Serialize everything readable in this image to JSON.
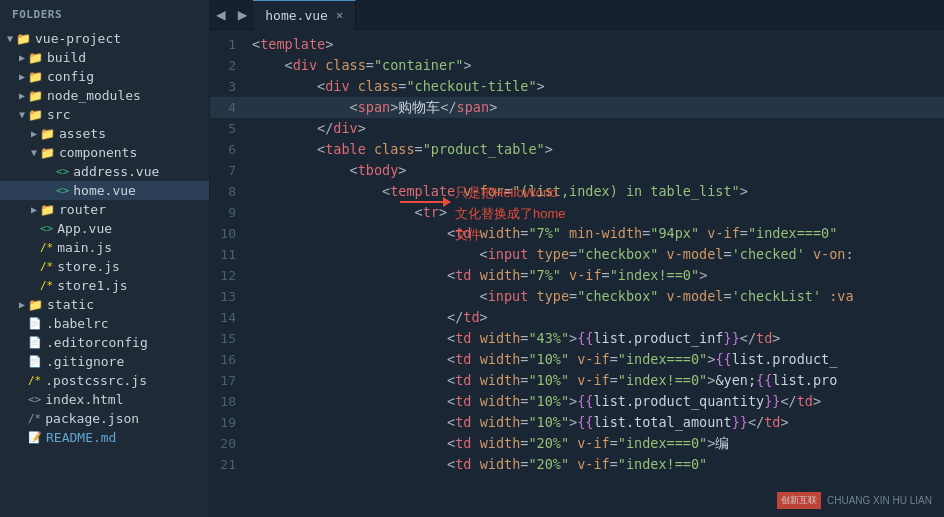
{
  "sidebar": {
    "header": "FOLDERS",
    "items": [
      {
        "id": "vue-project",
        "label": "vue-project",
        "type": "folder",
        "indent": 0,
        "arrow": "open"
      },
      {
        "id": "build",
        "label": "build",
        "type": "folder",
        "indent": 1,
        "arrow": "closed"
      },
      {
        "id": "config",
        "label": "config",
        "type": "folder",
        "indent": 1,
        "arrow": "closed"
      },
      {
        "id": "node_modules",
        "label": "node_modules",
        "type": "folder",
        "indent": 1,
        "arrow": "closed"
      },
      {
        "id": "src",
        "label": "src",
        "type": "folder",
        "indent": 1,
        "arrow": "open"
      },
      {
        "id": "assets",
        "label": "assets",
        "type": "folder",
        "indent": 2,
        "arrow": "closed"
      },
      {
        "id": "components",
        "label": "components",
        "type": "folder",
        "indent": 2,
        "arrow": "open"
      },
      {
        "id": "address-vue",
        "label": "address.vue",
        "type": "file-vue",
        "indent": 3,
        "arrow": "empty"
      },
      {
        "id": "home-vue",
        "label": "home.vue",
        "type": "file-vue",
        "indent": 3,
        "arrow": "empty",
        "selected": true
      },
      {
        "id": "router",
        "label": "router",
        "type": "folder",
        "indent": 2,
        "arrow": "closed"
      },
      {
        "id": "app-vue",
        "label": "App.vue",
        "type": "file-vue",
        "indent": 2,
        "arrow": "empty"
      },
      {
        "id": "main-js",
        "label": "main.js",
        "type": "file-js",
        "indent": 2,
        "arrow": "empty"
      },
      {
        "id": "store-js",
        "label": "store.js",
        "type": "file-js",
        "indent": 2,
        "arrow": "empty"
      },
      {
        "id": "store1-js",
        "label": "store1.js",
        "type": "file-js",
        "indent": 2,
        "arrow": "empty"
      },
      {
        "id": "static",
        "label": "static",
        "type": "folder",
        "indent": 1,
        "arrow": "closed"
      },
      {
        "id": "babelrc",
        "label": ".babelrc",
        "type": "file-other",
        "indent": 1,
        "arrow": "empty"
      },
      {
        "id": "editorconfig",
        "label": ".editorconfig",
        "type": "file-other",
        "indent": 1,
        "arrow": "empty"
      },
      {
        "id": "gitignore",
        "label": ".gitignore",
        "type": "file-other",
        "indent": 1,
        "arrow": "empty"
      },
      {
        "id": "postcssrc",
        "label": ".postcssrc.js",
        "type": "file-js",
        "indent": 1,
        "arrow": "empty"
      },
      {
        "id": "index-html",
        "label": "index.html",
        "type": "file-other",
        "indent": 1,
        "arrow": "empty"
      },
      {
        "id": "package-json",
        "label": "package.json",
        "type": "file-other",
        "indent": 1,
        "arrow": "empty"
      },
      {
        "id": "readme-md",
        "label": "README.md",
        "type": "file-md",
        "indent": 1,
        "arrow": "empty"
      }
    ]
  },
  "tabs": [
    {
      "label": "home.vue",
      "active": true
    }
  ],
  "code": {
    "lines": [
      {
        "n": 1,
        "html": "<span class='c-bracket'>&lt;</span><span class='c-tag'>template</span><span class='c-bracket'>&gt;</span>"
      },
      {
        "n": 2,
        "html": "    <span class='c-bracket'>&lt;</span><span class='c-tag'>div</span> <span class='c-attr'>class</span><span class='c-bracket'>=</span><span class='c-string'>\"container\"</span><span class='c-bracket'>&gt;</span>"
      },
      {
        "n": 3,
        "html": "        <span class='c-bracket'>&lt;</span><span class='c-tag'>div</span> <span class='c-attr'>class</span><span class='c-bracket'>=</span><span class='c-string'>\"checkout-title\"</span><span class='c-bracket'>&gt;</span>"
      },
      {
        "n": 4,
        "html": "            <span class='c-bracket'>&lt;</span><span class='c-tag'>span</span><span class='c-bracket'>&gt;</span><span class='c-text'>购物车</span><span class='c-bracket'>&lt;/</span><span class='c-tag'>span</span><span class='c-bracket'>&gt;</span>",
        "highlighted": true
      },
      {
        "n": 5,
        "html": "        <span class='c-bracket'>&lt;/</span><span class='c-tag'>div</span><span class='c-bracket'>&gt;</span>"
      },
      {
        "n": 6,
        "html": "        <span class='c-bracket'>&lt;</span><span class='c-tag'>table</span> <span class='c-attr'>class</span><span class='c-bracket'>=</span><span class='c-string'>\"product_table\"</span><span class='c-bracket'>&gt;</span>"
      },
      {
        "n": 7,
        "html": "            <span class='c-bracket'>&lt;</span><span class='c-tag'>tbody</span><span class='c-bracket'>&gt;</span>"
      },
      {
        "n": 8,
        "html": "                <span class='c-bracket'>&lt;</span><span class='c-tag'>template</span> <span class='c-attr'>v-for</span><span class='c-bracket'>=</span><span class='c-string'>\"(list,index) in table_list\"</span><span class='c-bracket'>&gt;</span>"
      },
      {
        "n": 9,
        "html": "                    <span class='c-bracket'>&lt;</span><span class='c-tag'>tr</span><span class='c-bracket'>&gt;</span>"
      },
      {
        "n": 10,
        "html": "                        <span class='c-bracket'>&lt;</span><span class='c-tag'>td</span> <span class='c-attr'>width</span><span class='c-bracket'>=</span><span class='c-string'>\"7%\"</span> <span class='c-attr'>min-width</span><span class='c-bracket'>=</span><span class='c-string'>\"94px\"</span> <span class='c-attr'>v-if</span><span class='c-bracket'>=</span><span class='c-string'>\"index===0\"</span>"
      },
      {
        "n": 11,
        "html": "                            <span class='c-bracket'>&lt;</span><span class='c-tag'>input</span> <span class='c-attr'>type</span><span class='c-bracket'>=</span><span class='c-string'>\"checkbox\"</span> <span class='c-attr'>v-model</span><span class='c-bracket'>=</span><span class='c-string'>'checked'</span> <span class='c-attr'>v-on</span><span class='c-bracket'>:</span>"
      },
      {
        "n": 12,
        "html": "                        <span class='c-bracket'>&lt;</span><span class='c-tag'>td</span> <span class='c-attr'>width</span><span class='c-bracket'>=</span><span class='c-string'>\"7%\"</span> <span class='c-attr'>v-if</span><span class='c-bracket'>=</span><span class='c-string'>\"index!==0\"</span><span class='c-bracket'>&gt;</span>"
      },
      {
        "n": 13,
        "html": "                            <span class='c-bracket'>&lt;</span><span class='c-tag'>input</span> <span class='c-attr'>type</span><span class='c-bracket'>=</span><span class='c-string'>\"checkbox\"</span> <span class='c-attr'>v-model</span><span class='c-bracket'>=</span><span class='c-string'>'checkList'</span> <span class='c-attr'>:va</span>"
      },
      {
        "n": 14,
        "html": "                        <span class='c-bracket'>&lt;/</span><span class='c-tag'>td</span><span class='c-bracket'>&gt;</span>"
      },
      {
        "n": 15,
        "html": "                        <span class='c-bracket'>&lt;</span><span class='c-tag'>td</span> <span class='c-attr'>width</span><span class='c-bracket'>=</span><span class='c-string'>\"43%\"</span><span class='c-bracket'>&gt;</span><span class='c-mustache'>{{</span><span class='c-text'>list.product_inf</span><span class='c-mustache'>}}</span><span class='c-bracket'>&lt;/</span><span class='c-tag'>td</span><span class='c-bracket'>&gt;</span>"
      },
      {
        "n": 16,
        "html": "                        <span class='c-bracket'>&lt;</span><span class='c-tag'>td</span> <span class='c-attr'>width</span><span class='c-bracket'>=</span><span class='c-string'>\"10%\"</span> <span class='c-attr'>v-if</span><span class='c-bracket'>=</span><span class='c-string'>\"index===0\"</span><span class='c-bracket'>&gt;</span><span class='c-mustache'>{{</span><span class='c-text'>list.product_</span>"
      },
      {
        "n": 17,
        "html": "                        <span class='c-bracket'>&lt;</span><span class='c-tag'>td</span> <span class='c-attr'>width</span><span class='c-bracket'>=</span><span class='c-string'>\"10%\"</span> <span class='c-attr'>v-if</span><span class='c-bracket'>=</span><span class='c-string'>\"index!==0\"</span><span class='c-bracket'>&gt;</span><span class='c-text'>&amp;yen;</span><span class='c-mustache'>{{</span><span class='c-text'>list.pro</span>"
      },
      {
        "n": 18,
        "html": "                        <span class='c-bracket'>&lt;</span><span class='c-tag'>td</span> <span class='c-attr'>width</span><span class='c-bracket'>=</span><span class='c-string'>\"10%\"</span><span class='c-bracket'>&gt;</span><span class='c-mustache'>{{</span><span class='c-text'>list.product_quantity</span><span class='c-mustache'>}}</span><span class='c-bracket'>&lt;/</span><span class='c-tag'>td</span><span class='c-bracket'>&gt;</span>"
      },
      {
        "n": 19,
        "html": "                        <span class='c-bracket'>&lt;</span><span class='c-tag'>td</span> <span class='c-attr'>width</span><span class='c-bracket'>=</span><span class='c-string'>\"10%\"</span><span class='c-bracket'>&gt;</span><span class='c-mustache'>{{</span><span class='c-text'>list.total_amount</span><span class='c-mustache'>}}</span><span class='c-bracket'>&lt;/</span><span class='c-tag'>td</span><span class='c-bracket'>&gt;</span>"
      },
      {
        "n": 20,
        "html": "                        <span class='c-bracket'>&lt;</span><span class='c-tag'>td</span> <span class='c-attr'>width</span><span class='c-bracket'>=</span><span class='c-string'>\"20%\"</span> <span class='c-attr'>v-if</span><span class='c-bracket'>=</span><span class='c-string'>\"index===0\"</span><span class='c-bracket'>&gt;</span><span class='c-text'>编</span>"
      },
      {
        "n": 21,
        "html": "                        <span class='c-bracket'>&lt;</span><span class='c-tag'>td</span> <span class='c-attr'>width</span><span class='c-bracket'>=</span><span class='c-string'>\"20%\"</span> <span class='c-attr'>v-if</span><span class='c-bracket'>=</span><span class='c-string'>\"index!==0\"</span>"
      }
    ]
  },
  "annotation": {
    "line1": "只是把HelloWorld",
    "line2": "文化替换成了home",
    "line3": "文件"
  },
  "watermark": {
    "brand": "创新互联",
    "subtitle": "CHUANG XIN HU LIAN"
  }
}
